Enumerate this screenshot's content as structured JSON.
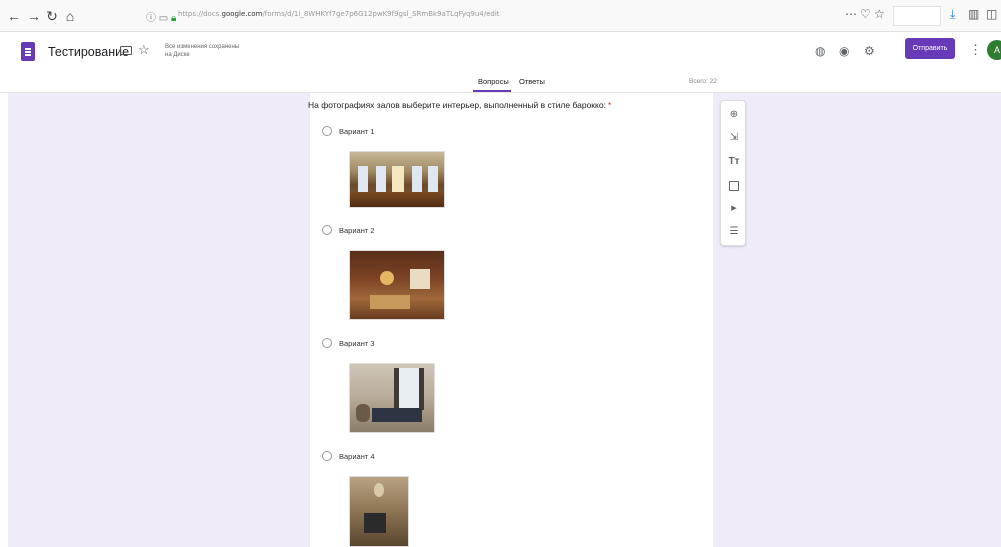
{
  "browser": {
    "url_prefix": "https://docs.",
    "url_domain": "google.com",
    "url_path": "/forms/d/1i_8WHKYf7ge7p6G12pwK9f9gsl_SRmBk9aTLqFyq9u4/edit"
  },
  "header": {
    "title": "Тестирование",
    "save_status_line1": "Все изменения сохранены",
    "save_status_line2": "на Диске",
    "send_label": "Отправить",
    "avatar_letter": "A",
    "accent_color": "#673ab7"
  },
  "tabs": {
    "questions": "Вопросы",
    "answers": "Ответы",
    "total": "Всего: 22"
  },
  "question": {
    "text": "На фотографиях залов выберите интерьер, выполненный в стиле барокко:",
    "required_mark": "*",
    "options": [
      {
        "label": "Вариант 1"
      },
      {
        "label": "Вариант 2"
      },
      {
        "label": "Вариант 3"
      },
      {
        "label": "Вариант 4"
      }
    ]
  },
  "toolbar_icons": [
    "add-question-icon",
    "import-questions-icon",
    "add-title-icon",
    "add-image-icon",
    "add-video-icon",
    "add-section-icon"
  ]
}
